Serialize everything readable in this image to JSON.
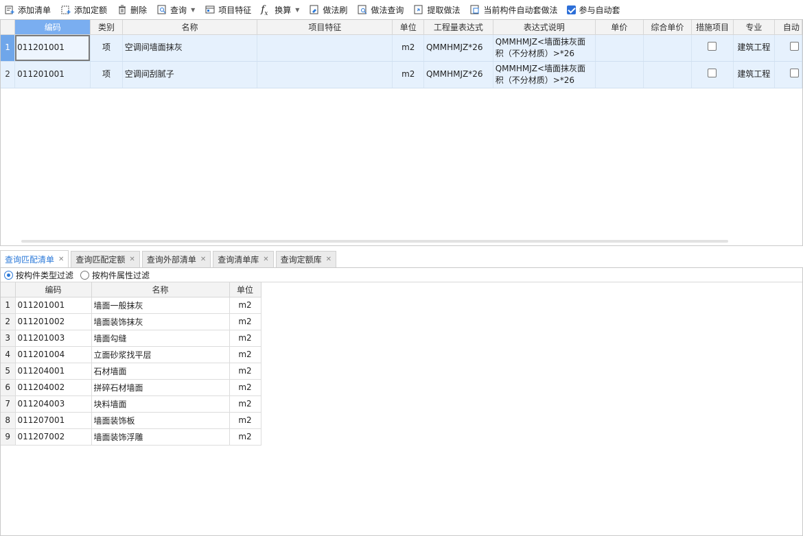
{
  "toolbar": {
    "add_list": "添加清单",
    "add_quota": "添加定额",
    "delete": "删除",
    "query": "查询",
    "item_feature": "项目特征",
    "convert": "换算",
    "method_brush": "做法刷",
    "method_query": "做法查询",
    "extract_method": "提取做法",
    "auto_apply": "当前构件自动套做法",
    "join_auto": "参与自动套",
    "join_auto_checked": true
  },
  "top_grid": {
    "headers": [
      "编码",
      "类别",
      "名称",
      "项目特征",
      "单位",
      "工程量表达式",
      "表达式说明",
      "单价",
      "综合单价",
      "措施项目",
      "专业",
      "自动"
    ],
    "rows": [
      {
        "num": "1",
        "code": "011201001",
        "type": "项",
        "name": "空调间墙面抹灰",
        "feature": "",
        "unit": "m2",
        "expr": "QMMHMJZ*26",
        "desc1": "QMMHMJZ<墙面抹灰面",
        "desc2": "积（不分材质）>*26",
        "price": "",
        "comp_price": "",
        "measure": false,
        "major": "建筑工程"
      },
      {
        "num": "2",
        "code": "011201001",
        "type": "项",
        "name": "空调间刮腻子",
        "feature": "",
        "unit": "m2",
        "expr": "QMMHMJZ*26",
        "desc1": "QMMHMJZ<墙面抹灰面",
        "desc2": "积（不分材质）>*26",
        "price": "",
        "comp_price": "",
        "measure": false,
        "major": "建筑工程"
      }
    ]
  },
  "tabs": [
    {
      "label": "查询匹配清单",
      "active": true
    },
    {
      "label": "查询匹配定额",
      "active": false
    },
    {
      "label": "查询外部清单",
      "active": false
    },
    {
      "label": "查询清单库",
      "active": false
    },
    {
      "label": "查询定额库",
      "active": false
    }
  ],
  "filter": {
    "by_type": "按构件类型过滤",
    "by_attr": "按构件属性过滤",
    "selected": "by_type"
  },
  "bottom_grid": {
    "headers": [
      "编码",
      "名称",
      "单位"
    ],
    "rows": [
      {
        "num": "1",
        "code": "011201001",
        "name": "墙面一般抹灰",
        "unit": "m2"
      },
      {
        "num": "2",
        "code": "011201002",
        "name": "墙面装饰抹灰",
        "unit": "m2"
      },
      {
        "num": "3",
        "code": "011201003",
        "name": "墙面勾缝",
        "unit": "m2"
      },
      {
        "num": "4",
        "code": "011201004",
        "name": "立面砂浆找平层",
        "unit": "m2"
      },
      {
        "num": "5",
        "code": "011204001",
        "name": "石材墙面",
        "unit": "m2"
      },
      {
        "num": "6",
        "code": "011204002",
        "name": "拼碎石材墙面",
        "unit": "m2"
      },
      {
        "num": "7",
        "code": "011204003",
        "name": "块料墙面",
        "unit": "m2"
      },
      {
        "num": "8",
        "code": "011207001",
        "name": "墙面装饰板",
        "unit": "m2"
      },
      {
        "num": "9",
        "code": "011207002",
        "name": "墙面装饰浮雕",
        "unit": "m2"
      }
    ]
  }
}
